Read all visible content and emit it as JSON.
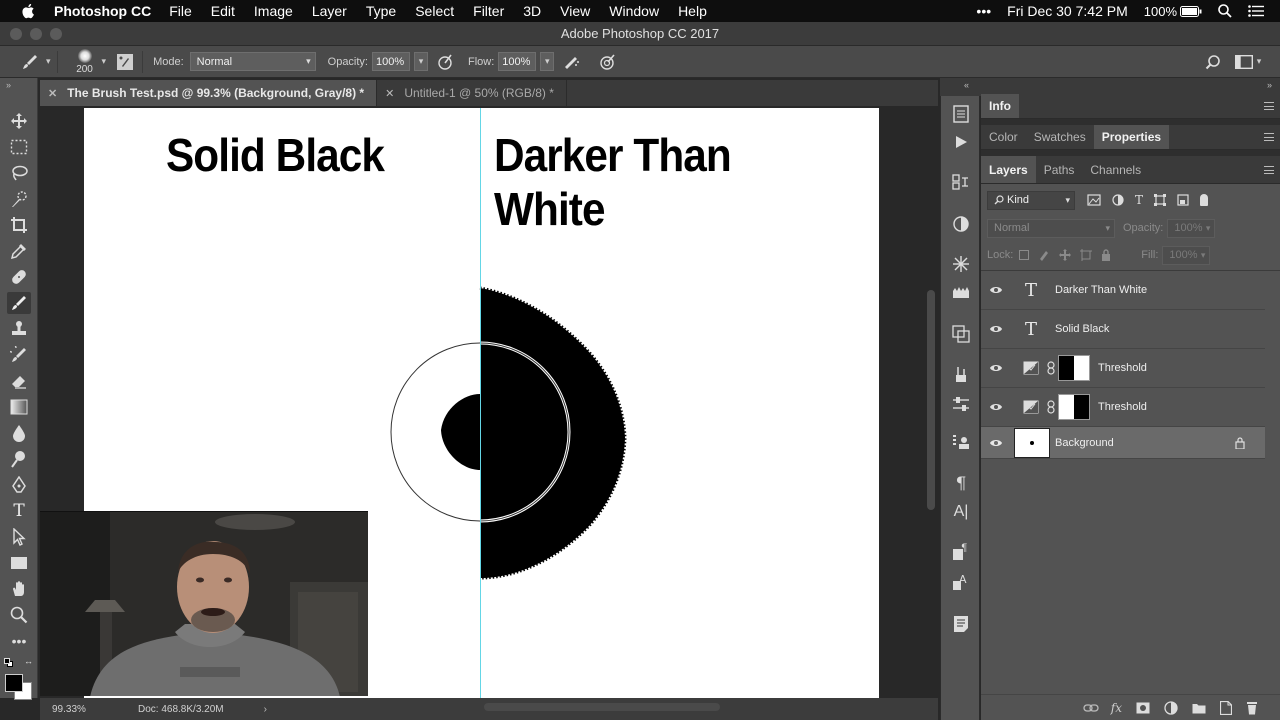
{
  "menubar": {
    "app_name": "Photoshop CC",
    "items": [
      "File",
      "Edit",
      "Image",
      "Layer",
      "Type",
      "Select",
      "Filter",
      "3D",
      "View",
      "Window",
      "Help"
    ],
    "more": "•••",
    "datetime": "Fri Dec 30  7:42 PM",
    "battery": "100%"
  },
  "window": {
    "title": "Adobe Photoshop CC 2017"
  },
  "options": {
    "brush_size": "200",
    "mode_label": "Mode:",
    "mode_value": "Normal",
    "opacity_label": "Opacity:",
    "opacity_value": "100%",
    "flow_label": "Flow:",
    "flow_value": "100%"
  },
  "doc_tabs": [
    {
      "label": "The Brush Test.psd @ 99.3% (Background, Gray/8) *",
      "active": true
    },
    {
      "label": "Untitled-1 @ 50% (RGB/8) *",
      "active": false
    }
  ],
  "canvas": {
    "text_left": "Solid Black",
    "text_right": "Darker Than White"
  },
  "status": {
    "zoom": "99.33%",
    "doc": "Doc: 468.8K/3.20M"
  },
  "panels": {
    "info_tab": "Info",
    "tabs_row2": [
      "Color",
      "Swatches",
      "Properties"
    ],
    "layers_tabs": [
      "Layers",
      "Paths",
      "Channels"
    ],
    "filter_kind": "Kind",
    "blend_mode": "Normal",
    "opacity_label": "Opacity:",
    "opacity_value": "100%",
    "lock_label": "Lock:",
    "fill_label": "Fill:",
    "fill_value": "100%"
  },
  "layers": [
    {
      "name": "Darker Than White",
      "kind": "text"
    },
    {
      "name": "Solid Black",
      "kind": "text"
    },
    {
      "name": "Threshold",
      "kind": "adjustment",
      "mask": "black-left"
    },
    {
      "name": "Threshold",
      "kind": "adjustment",
      "mask": "white-left"
    },
    {
      "name": "Background",
      "kind": "background",
      "locked": true
    }
  ],
  "footer_icons": [
    "link-icon",
    "fx-icon",
    "mask-icon",
    "adjustment-icon",
    "group-icon",
    "new-layer-icon",
    "trash-icon"
  ]
}
